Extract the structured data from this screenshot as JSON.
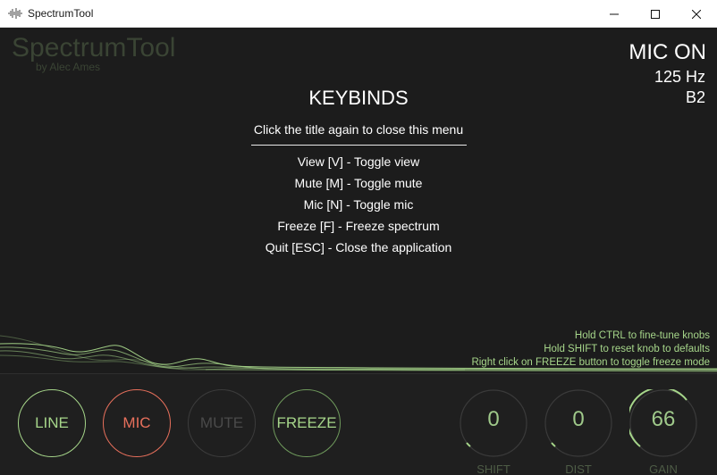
{
  "window": {
    "title": "SpectrumTool",
    "icon": "waveform-icon",
    "controls": [
      "minimize-icon",
      "maximize-icon",
      "close-icon"
    ]
  },
  "logo": {
    "title": "SpectrumTool",
    "subtitle": "by Alec Ames"
  },
  "status": {
    "mic": "MIC ON",
    "frequency": "125 Hz",
    "note": "B2"
  },
  "keybinds": {
    "title": "KEYBINDS",
    "hint": "Click the title again to close this menu",
    "items": [
      "View [V] - Toggle view",
      "Mute [M] - Toggle mute",
      "Mic [N] - Toggle mic",
      "Freeze [F] - Freeze spectrum",
      "Quit [ESC] - Close the application"
    ]
  },
  "tips": [
    "Hold CTRL to fine-tune knobs",
    "Hold SHIFT to reset knob to defaults",
    "Right click on FREEZE button to toggle freeze mode"
  ],
  "buttons": {
    "line": "LINE",
    "mic": "MIC",
    "mute": "MUTE",
    "freeze": "FREEZE"
  },
  "knobs": {
    "shift": {
      "label": "SHIFT",
      "value": "0",
      "level": 0.0
    },
    "dist": {
      "label": "DIST",
      "value": "0",
      "level": 0.0
    },
    "gain": {
      "label": "GAIN",
      "value": "66",
      "level": 0.66
    }
  },
  "colors": {
    "accent_green": "#a6d68a",
    "mic_red": "#e8705c",
    "muted_gray": "#3c3c3c",
    "background": "#1c1c1c"
  }
}
